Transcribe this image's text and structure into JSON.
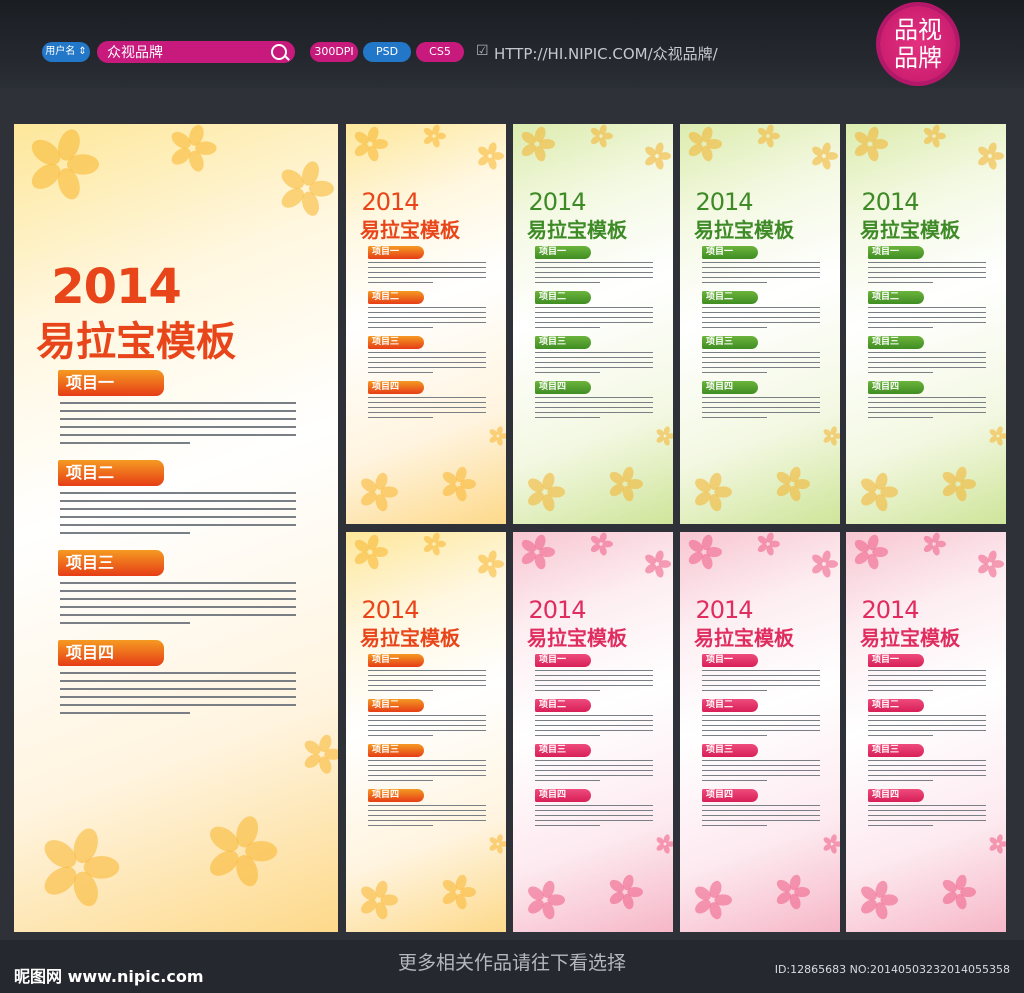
{
  "header": {
    "user_label": "用户名 ⇕",
    "search_value": "众视品牌",
    "badges": [
      "300DPI",
      "PSD",
      "CS5"
    ],
    "url": "HTTP://HI.NIPIC.COM/众视品牌/",
    "logo_text": "品视\n品牌"
  },
  "banner_template": {
    "year": "2014",
    "title": "易拉宝模板",
    "sections": [
      "项目一",
      "项目二",
      "项目三",
      "项目四"
    ]
  },
  "footer": {
    "center": "更多相关作品请往下看选择",
    "left": "昵图网 www.nipic.com",
    "right": "ID:12865683 NO:20140503232014055358"
  },
  "colors": {
    "magenta": "#c8197d",
    "blue": "#2277c9",
    "orange": "#f07a1a",
    "green": "#4f9d2b",
    "pink": "#e2336c"
  }
}
